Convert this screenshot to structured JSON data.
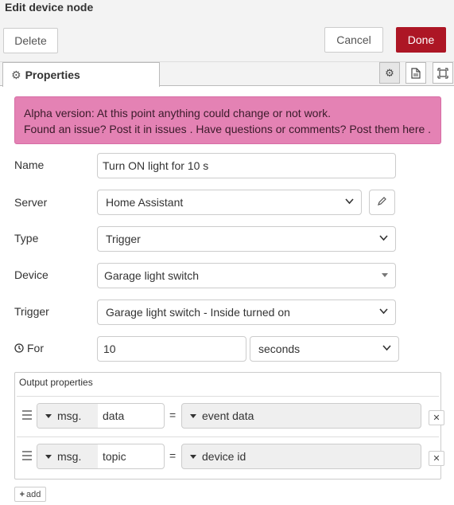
{
  "header": {
    "title": "Edit device node",
    "delete_label": "Delete",
    "cancel_label": "Cancel",
    "done_label": "Done",
    "done_color": "#ad1625"
  },
  "tabs": {
    "properties_label": "Properties",
    "icons": [
      "gear-icon",
      "document-icon",
      "frame-icon"
    ]
  },
  "alert": {
    "line1": "Alpha version: At this point anything could change or not work.",
    "line2_a": "Found an issue? Post it in ",
    "issues_link": "issues",
    "line2_b": " . Have questions or comments? Post them ",
    "here_link": "here",
    "line2_c": " .",
    "bg_color": "#e482b4"
  },
  "form": {
    "name_label": "Name",
    "name_value": "Turn ON light for 10 s",
    "server_label": "Server",
    "server_value": "Home Assistant",
    "type_label": "Type",
    "type_value": "Trigger",
    "device_label": "Device",
    "device_value": "Garage light switch",
    "trigger_label": "Trigger",
    "trigger_value": "Garage light switch - Inside turned on",
    "for_label": "For",
    "for_value": "10",
    "for_unit": "seconds"
  },
  "output": {
    "title": "Output properties",
    "rows": [
      {
        "type": "msg.",
        "property": "data",
        "value": "event data"
      },
      {
        "type": "msg.",
        "property": "topic",
        "value": "device id"
      }
    ],
    "add_label": "add"
  }
}
